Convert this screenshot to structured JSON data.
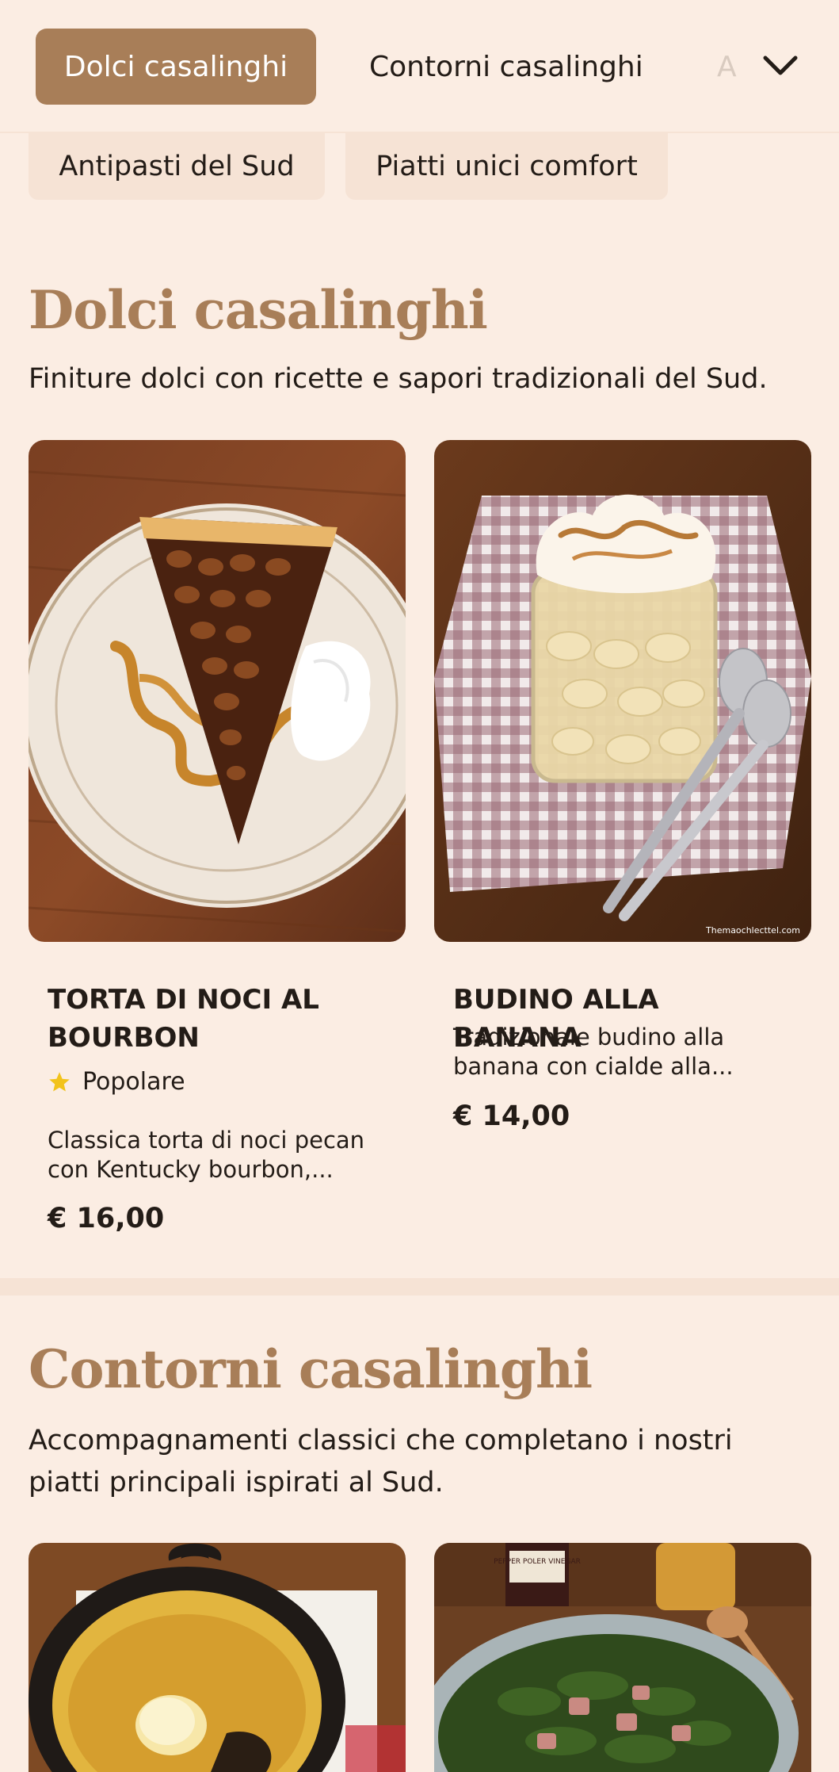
{
  "nav": {
    "tabs": [
      {
        "label": "Dolci casalinghi",
        "active": true
      },
      {
        "label": "Contorni casalinghi",
        "active": false
      },
      {
        "label": "A",
        "active": false
      }
    ],
    "pills": [
      "Antipasti del Sud",
      "Piatti unici comfort"
    ],
    "expand_icon": "chevron-down-icon"
  },
  "sections": [
    {
      "title": "Dolci casalinghi",
      "description": "Finiture dolci con ricette e sapori tradizionali del Sud.",
      "items": [
        {
          "title": "TORTA DI NOCI AL BOURBON",
          "badge": "Popolare",
          "badge_icon": "star-icon",
          "description": "Classica torta di noci pecan con Kentucky bourbon,...",
          "price": "€ 16,00"
        },
        {
          "title": "BUDINO ALLA BANANA",
          "description": "Tradizionale budino alla banana con cialde alla...",
          "price": "€ 14,00",
          "image_watermark": "Themaochlecttel.com"
        }
      ]
    },
    {
      "title": "Contorni casalinghi",
      "description": "Accompagnamenti classici che completano i nostri piatti principali ispirati al Sud.",
      "items": [
        {
          "image_label": "PEPPER POLER VINEGAR"
        },
        {}
      ]
    }
  ],
  "colors": {
    "background": "#fbede3",
    "accent": "#a87e58",
    "pill": "#f6e3d5",
    "text": "#231c17",
    "star": "#f2c31b"
  }
}
